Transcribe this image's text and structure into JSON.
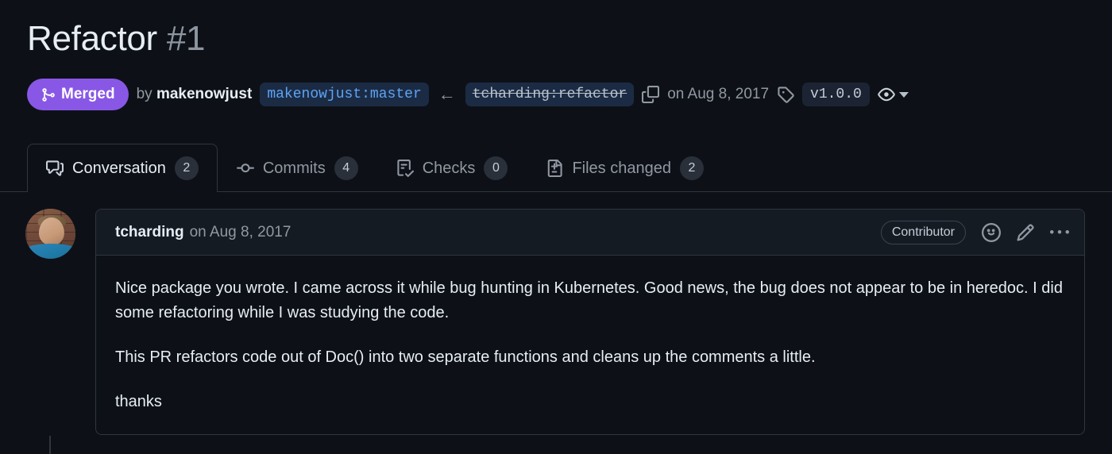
{
  "header": {
    "title": "Refactor",
    "number": "#1",
    "state_badge": {
      "label": "Merged",
      "icon": "git-merge-icon",
      "color": "#8957e5"
    },
    "by_label": "by",
    "author": "makenowjust",
    "head_branch": "makenowjust:master",
    "arrow": "←",
    "base_branch": "tcharding:refactor",
    "copy_icon": "copy-icon",
    "date": "on Aug 8, 2017",
    "tag_icon": "tag-icon",
    "tag": "v1.0.0",
    "watch_icon": "eye-icon"
  },
  "tabs": [
    {
      "label": "Conversation",
      "count": "2",
      "icon": "comment-discussion-icon",
      "active": true
    },
    {
      "label": "Commits",
      "count": "4",
      "icon": "git-commit-icon",
      "active": false
    },
    {
      "label": "Checks",
      "count": "0",
      "icon": "checklist-icon",
      "active": false
    },
    {
      "label": "Files changed",
      "count": "2",
      "icon": "file-diff-icon",
      "active": false
    }
  ],
  "comment": {
    "author": "tcharding",
    "date": "on Aug 8, 2017",
    "badge": "Contributor",
    "actions": {
      "react_icon": "smiley-icon",
      "edit_icon": "pencil-icon",
      "more_icon": "kebab-horizontal-icon"
    },
    "paragraphs": [
      "Nice package you wrote. I came across it while bug hunting in Kubernetes. Good news, the bug does not appear to be in heredoc. I did some refactoring while I was studying the code.",
      "This PR refactors code out of Doc() into two separate functions and cleans up the comments a little.",
      "thanks"
    ]
  },
  "colors": {
    "background": "#0d1117",
    "border": "#30363d",
    "text_primary": "#e6edf3",
    "text_muted": "#9198a1",
    "merged_purple": "#8957e5",
    "branch_chip_bg": "#1c2b44",
    "branch_link": "#5ca5f5"
  }
}
